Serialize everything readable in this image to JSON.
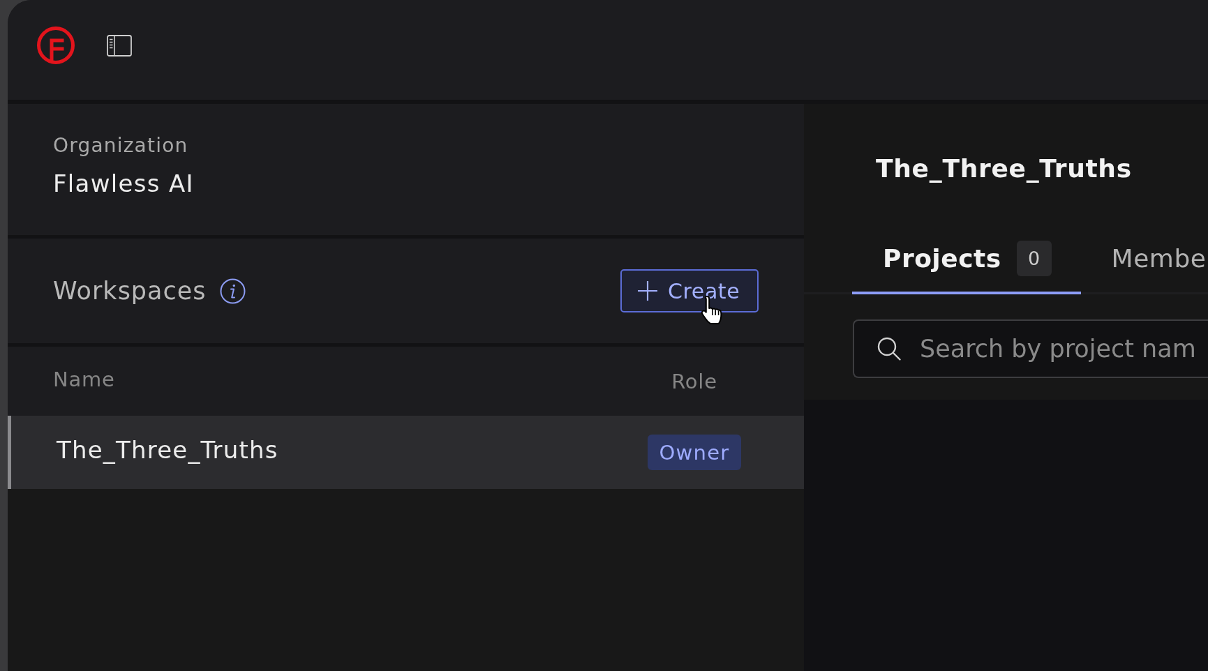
{
  "organization": {
    "label": "Organization",
    "name": "Flawless AI"
  },
  "workspaces": {
    "title": "Workspaces",
    "create_button": {
      "label": "Create"
    },
    "table": {
      "columns": [
        "Name",
        "Role"
      ],
      "rows": [
        {
          "name": "The_Three_Truths",
          "role": "Owner",
          "selected": true
        }
      ]
    }
  },
  "workspace_detail": {
    "title": "The_Three_Truths",
    "tabs": [
      {
        "label": "Projects",
        "count": "0",
        "selected": true
      },
      {
        "label": "Membe",
        "selected": false
      }
    ],
    "search": {
      "placeholder": "Search by project nam"
    }
  }
}
